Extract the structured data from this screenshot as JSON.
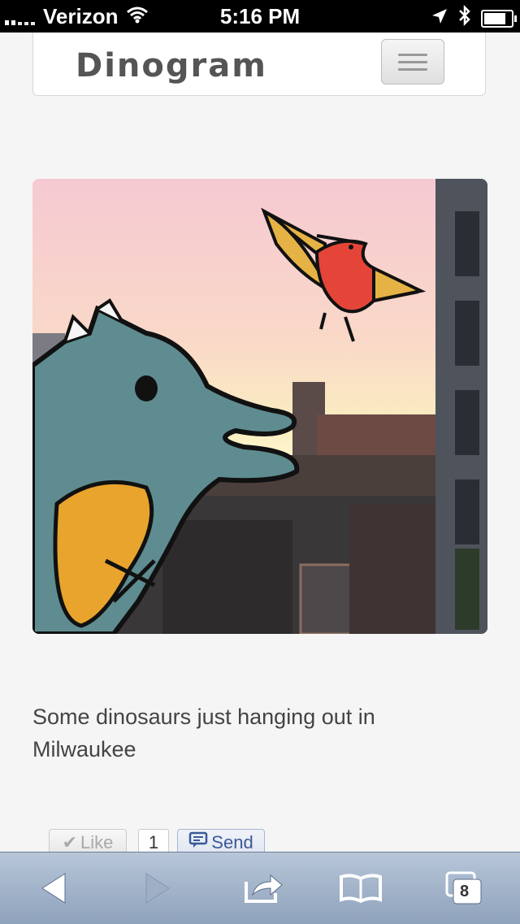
{
  "status_bar": {
    "carrier": "Verizon",
    "time": "5:16 PM",
    "icons": [
      "signal-icon",
      "wifi-icon",
      "location-icon",
      "bluetooth-icon",
      "battery-icon"
    ]
  },
  "navbar": {
    "brand": "Dinogram",
    "menu_icon": "hamburger-icon"
  },
  "post": {
    "caption": "Some dinosaurs just hanging out in Milwaukee",
    "like_label": "Like",
    "like_count": "1",
    "send_label": "Send"
  },
  "toolbar": {
    "icons": [
      "back-icon",
      "forward-icon",
      "share-icon",
      "bookmarks-icon",
      "tabs-icon"
    ],
    "tab_count": "8"
  },
  "colors": {
    "toolbar_top": "#b8c6d8",
    "toolbar_bottom": "#8ea2bc",
    "send_blue": "#3b5998"
  }
}
